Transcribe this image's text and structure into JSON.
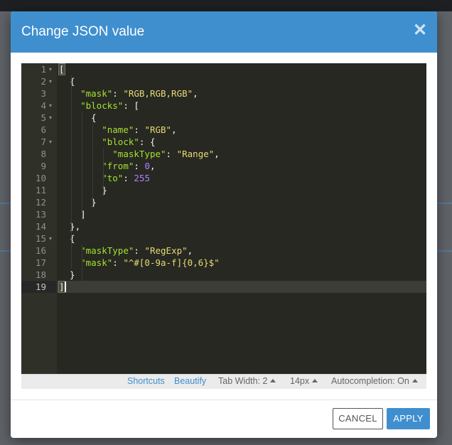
{
  "dialog": {
    "title": "Change JSON value",
    "close_symbol": "✕",
    "cancel_label": "CANCEL",
    "apply_label": "APPLY"
  },
  "editor": {
    "lines": [
      {
        "num": "1",
        "fold": true,
        "tokens": [
          [
            "punc",
            "["
          ]
        ]
      },
      {
        "num": "2",
        "fold": true,
        "tokens": [
          [
            "punc",
            "  {"
          ]
        ]
      },
      {
        "num": "3",
        "fold": false,
        "tokens": [
          [
            "punc",
            "    "
          ],
          [
            "key",
            "\"mask\""
          ],
          [
            "punc",
            ": "
          ],
          [
            "str",
            "\"RGB,RGB,RGB\""
          ],
          [
            "punc",
            ","
          ]
        ]
      },
      {
        "num": "4",
        "fold": true,
        "tokens": [
          [
            "punc",
            "    "
          ],
          [
            "key",
            "\"blocks\""
          ],
          [
            "punc",
            ": ["
          ]
        ]
      },
      {
        "num": "5",
        "fold": true,
        "tokens": [
          [
            "punc",
            "      {"
          ]
        ]
      },
      {
        "num": "6",
        "fold": false,
        "tokens": [
          [
            "punc",
            "        "
          ],
          [
            "key",
            "\"name\""
          ],
          [
            "punc",
            ": "
          ],
          [
            "str",
            "\"RGB\""
          ],
          [
            "punc",
            ","
          ]
        ]
      },
      {
        "num": "7",
        "fold": true,
        "tokens": [
          [
            "punc",
            "        "
          ],
          [
            "key",
            "\"block\""
          ],
          [
            "punc",
            ": {"
          ]
        ]
      },
      {
        "num": "8",
        "fold": false,
        "tokens": [
          [
            "punc",
            "          "
          ],
          [
            "key",
            "\"maskType\""
          ],
          [
            "punc",
            ": "
          ],
          [
            "str",
            "\"Range\""
          ],
          [
            "punc",
            ","
          ]
        ]
      },
      {
        "num": "9",
        "fold": false,
        "tokens": [
          [
            "punc",
            "        "
          ],
          [
            "key",
            "\"from\""
          ],
          [
            "punc",
            ": "
          ],
          [
            "num",
            "0"
          ],
          [
            "punc",
            ","
          ]
        ]
      },
      {
        "num": "10",
        "fold": false,
        "tokens": [
          [
            "punc",
            "        "
          ],
          [
            "key",
            "\"to\""
          ],
          [
            "punc",
            ": "
          ],
          [
            "num",
            "255"
          ]
        ]
      },
      {
        "num": "11",
        "fold": false,
        "tokens": [
          [
            "punc",
            "        }"
          ]
        ]
      },
      {
        "num": "12",
        "fold": false,
        "tokens": [
          [
            "punc",
            "      }"
          ]
        ]
      },
      {
        "num": "13",
        "fold": false,
        "tokens": [
          [
            "punc",
            "    ]"
          ]
        ]
      },
      {
        "num": "14",
        "fold": false,
        "tokens": [
          [
            "punc",
            "  },"
          ]
        ]
      },
      {
        "num": "15",
        "fold": true,
        "tokens": [
          [
            "punc",
            "  {"
          ]
        ]
      },
      {
        "num": "16",
        "fold": false,
        "tokens": [
          [
            "punc",
            "    "
          ],
          [
            "key",
            "\"maskType\""
          ],
          [
            "punc",
            ": "
          ],
          [
            "str",
            "\"RegExp\""
          ],
          [
            "punc",
            ","
          ]
        ]
      },
      {
        "num": "17",
        "fold": false,
        "tokens": [
          [
            "punc",
            "    "
          ],
          [
            "key",
            "\"mask\""
          ],
          [
            "punc",
            ": "
          ],
          [
            "str",
            "\"^#[0-9a-f]{0,6}$\""
          ]
        ]
      },
      {
        "num": "18",
        "fold": false,
        "tokens": [
          [
            "punc",
            "  }"
          ]
        ]
      },
      {
        "num": "19",
        "fold": false,
        "active": true,
        "tokens": [
          [
            "punc",
            "]"
          ]
        ]
      }
    ]
  },
  "statusbar": {
    "shortcuts": "Shortcuts",
    "beautify": "Beautify",
    "tab_width": "Tab Width: 2",
    "font_size": "14px",
    "autocompletion": "Autocompletion: On"
  },
  "colors": {
    "header": "#3f8fcf",
    "editor_bg": "#272822",
    "key": "#a6e22e",
    "string": "#e6db74",
    "number": "#ae81ff"
  }
}
